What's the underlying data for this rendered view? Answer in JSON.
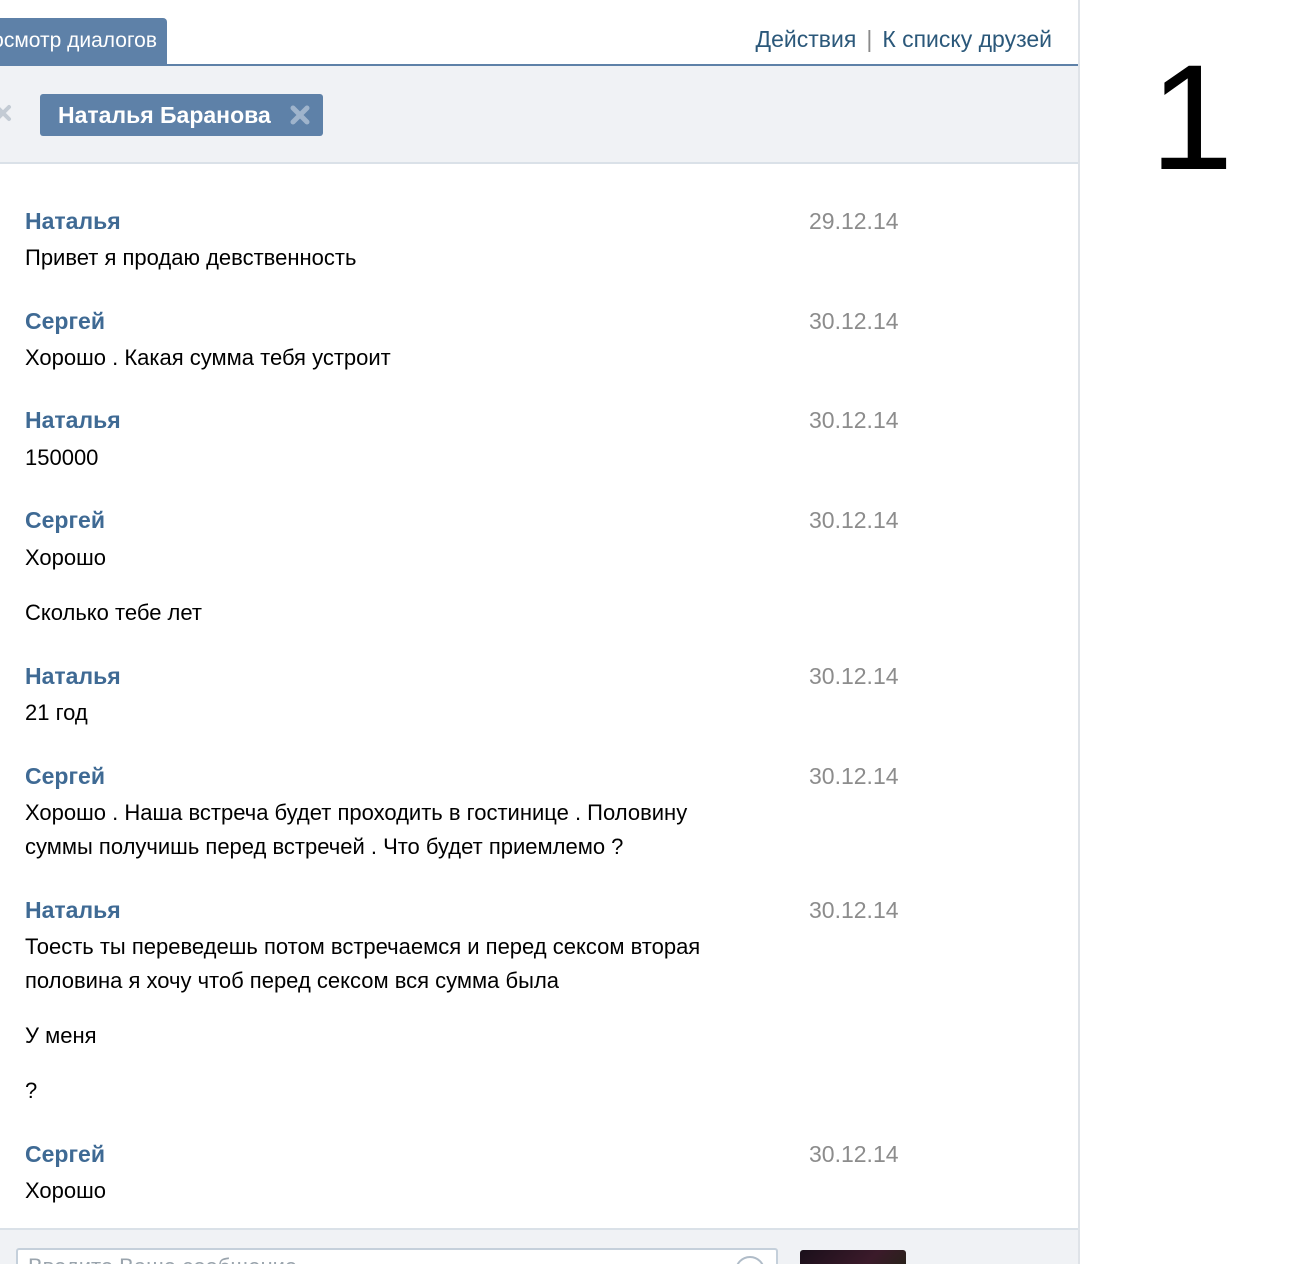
{
  "tabs": {
    "active_label": "Просмотр диалогов"
  },
  "header_links": {
    "actions": "Действия",
    "separator": "|",
    "friends": "К списку друзей"
  },
  "recipient": {
    "name": "Наталья Баранова"
  },
  "messages": [
    {
      "author": "Наталья",
      "date": "29.12.14",
      "lines": [
        "Привет я продаю девственность"
      ]
    },
    {
      "author": "Сергей",
      "date": "30.12.14",
      "lines": [
        "Хорошо . Какая сумма тебя устроит"
      ]
    },
    {
      "author": "Наталья",
      "date": "30.12.14",
      "lines": [
        "150000"
      ]
    },
    {
      "author": "Сергей",
      "date": "30.12.14",
      "lines": [
        "Хорошо",
        "Сколько тебе лет"
      ]
    },
    {
      "author": "Наталья",
      "date": "30.12.14",
      "lines": [
        "21 год"
      ]
    },
    {
      "author": "Сергей",
      "date": "30.12.14",
      "lines": [
        "Хорошо . Наша встреча будет проходить в гостинице . Половину",
        "суммы получишь перед встречей . Что будет приемлемо ?"
      ]
    },
    {
      "author": "Наталья",
      "date": "30.12.14",
      "lines": [
        "Тоесть ты переведешь потом встречаемся и перед сексом вторая",
        "половина я хочу чтоб перед сексом вся сумма была",
        "У меня",
        "?"
      ]
    },
    {
      "author": "Сергей",
      "date": "30.12.14",
      "lines": [
        "Хорошо"
      ]
    }
  ],
  "composer": {
    "placeholder": "Введите Ваше сообщение..."
  },
  "page_number": "1",
  "colors": {
    "accent": "#5e81a8",
    "author": "#3f6a94",
    "date": "#8c8c8c",
    "link": "#2b587a",
    "panel_bg": "#f0f2f5"
  }
}
